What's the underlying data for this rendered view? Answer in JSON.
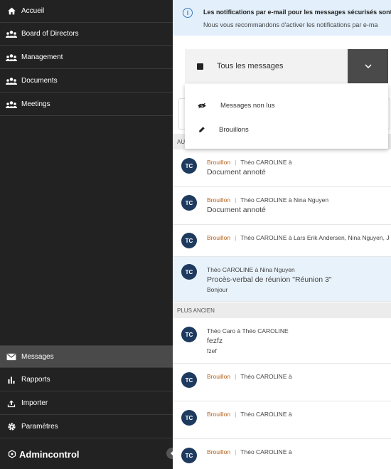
{
  "sidebar": {
    "items": [
      {
        "label": "Accueil",
        "icon": "home-icon"
      },
      {
        "label": "Board of Directors",
        "icon": "people-icon"
      },
      {
        "label": "Management",
        "icon": "people-icon"
      },
      {
        "label": "Documents",
        "icon": "people-icon"
      },
      {
        "label": "Meetings",
        "icon": "people-icon"
      }
    ],
    "bottom_items": [
      {
        "label": "Messages",
        "icon": "mail-icon",
        "active": true
      },
      {
        "label": "Rapports",
        "icon": "bar-chart-icon"
      },
      {
        "label": "Importer",
        "icon": "upload-icon"
      },
      {
        "label": "Paramètres",
        "icon": "gear-icon"
      }
    ],
    "brand": "Admincontrol"
  },
  "banner": {
    "title": "Les notifications par e-mail pour les messages sécurisés sont",
    "body": "Nous vous recommandons d'activer les notifications par e-ma"
  },
  "filter": {
    "selected": "Tous les messages",
    "options": [
      {
        "label": "Messages non lus",
        "icon": "eye-off-icon"
      },
      {
        "label": "Brouillons",
        "icon": "pencil-icon"
      }
    ]
  },
  "sections": {
    "today_partial": "AU",
    "older": "PLUS ANCIEN"
  },
  "messages": [
    {
      "initials": "TC",
      "draft": "Brouillon",
      "meta": "Théo CAROLINE à",
      "subject": "Document annoté",
      "preview": ""
    },
    {
      "initials": "TC",
      "draft": "Brouillon",
      "meta": "Théo CAROLINE à Nina Nguyen",
      "subject": "Document annoté",
      "preview": ""
    },
    {
      "initials": "TC",
      "draft": "Brouillon",
      "meta": "Théo CAROLINE à Lars Erik Andersen, Nina Nguyen, J",
      "subject": "",
      "preview": ""
    },
    {
      "initials": "TC",
      "draft": "",
      "meta": "Théo CAROLINE à Nina Nguyen",
      "subject": "Procès-verbal de réunion \"Réunion 3\"",
      "preview": "Bonjour"
    },
    {
      "initials": "TC",
      "draft": "",
      "meta": "Théo Caro à Théo CAROLINE",
      "subject": "fezfz",
      "preview": "fzef"
    },
    {
      "initials": "TC",
      "draft": "Brouillon",
      "meta": "Théo CAROLINE à",
      "subject": "",
      "preview": ""
    },
    {
      "initials": "TC",
      "draft": "Brouillon",
      "meta": "Théo CAROLINE à",
      "subject": "",
      "preview": ""
    },
    {
      "initials": "TC",
      "draft": "Brouillon",
      "meta": "Théo CAROLINE à",
      "subject": "",
      "preview": ""
    }
  ],
  "colors": {
    "sidebar_bg": "#222222",
    "active_bg": "#4a4a4a",
    "avatar_bg": "#1e3a5f",
    "draft": "#b5621e",
    "banner_bg": "#e3f0fb",
    "highlight_bg": "#e8f2fb"
  }
}
